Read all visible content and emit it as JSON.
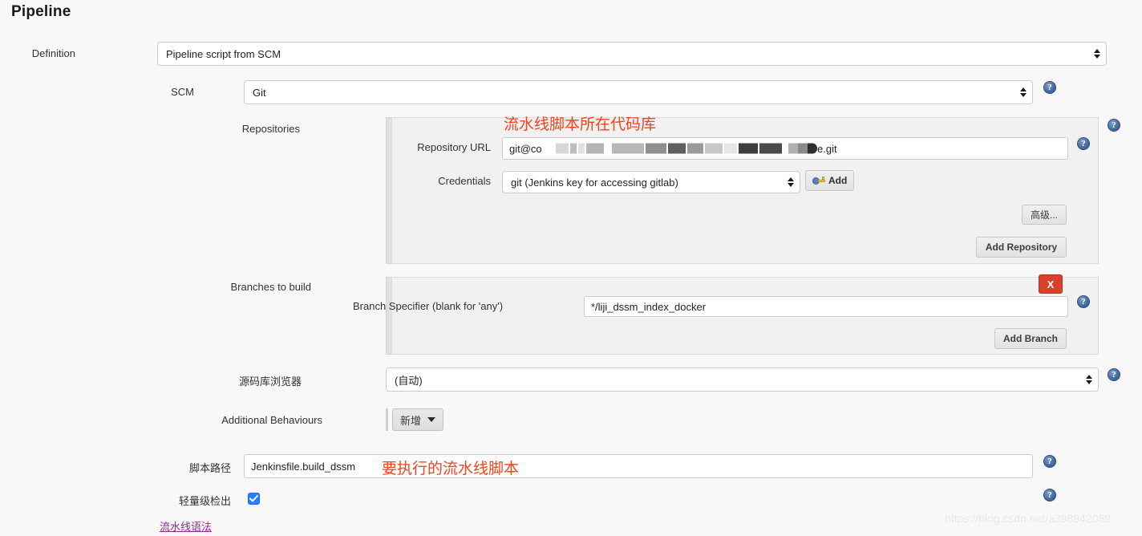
{
  "page": {
    "title": "Pipeline"
  },
  "definition": {
    "label": "Definition",
    "value": "Pipeline script from SCM"
  },
  "scm": {
    "label": "SCM",
    "value": "Git"
  },
  "repositories": {
    "label": "Repositories",
    "annotation": "流水线脚本所在代码库",
    "repository_url": {
      "label": "Repository URL",
      "value_prefix": "git@co",
      "value_suffix": "e.git"
    },
    "credentials": {
      "label": "Credentials",
      "value": "git (Jenkins key for accessing gitlab)",
      "add_button": "Add"
    },
    "advanced_button": "高级...",
    "add_repository_button": "Add Repository"
  },
  "branches": {
    "label": "Branches to build",
    "delete_button": "X",
    "branch_specifier": {
      "label": "Branch Specifier (blank for 'any')",
      "value": "*/liji_dssm_index_docker"
    },
    "add_branch_button": "Add Branch"
  },
  "repository_browser": {
    "label": "源码库浏览器",
    "value": "(自动)"
  },
  "additional_behaviours": {
    "label": "Additional Behaviours",
    "add_button": "新增"
  },
  "script_path": {
    "label": "脚本路径",
    "value": "Jenkinsfile.build_dssm",
    "annotation": "要执行的流水线脚本"
  },
  "lightweight_checkout": {
    "label": "轻量级检出",
    "checked": true
  },
  "pipeline_syntax_link": "流水线语法",
  "watermark": "https://blog.csdn.net/a398942089",
  "help_icon_glyph": "?",
  "colors": {
    "annotation_red": "#f4421a",
    "delete_red": "#d9412b",
    "checkbox_blue": "#2b7fff",
    "help_blue": "#4a6fa5",
    "link_purple": "#8a2f8a"
  }
}
